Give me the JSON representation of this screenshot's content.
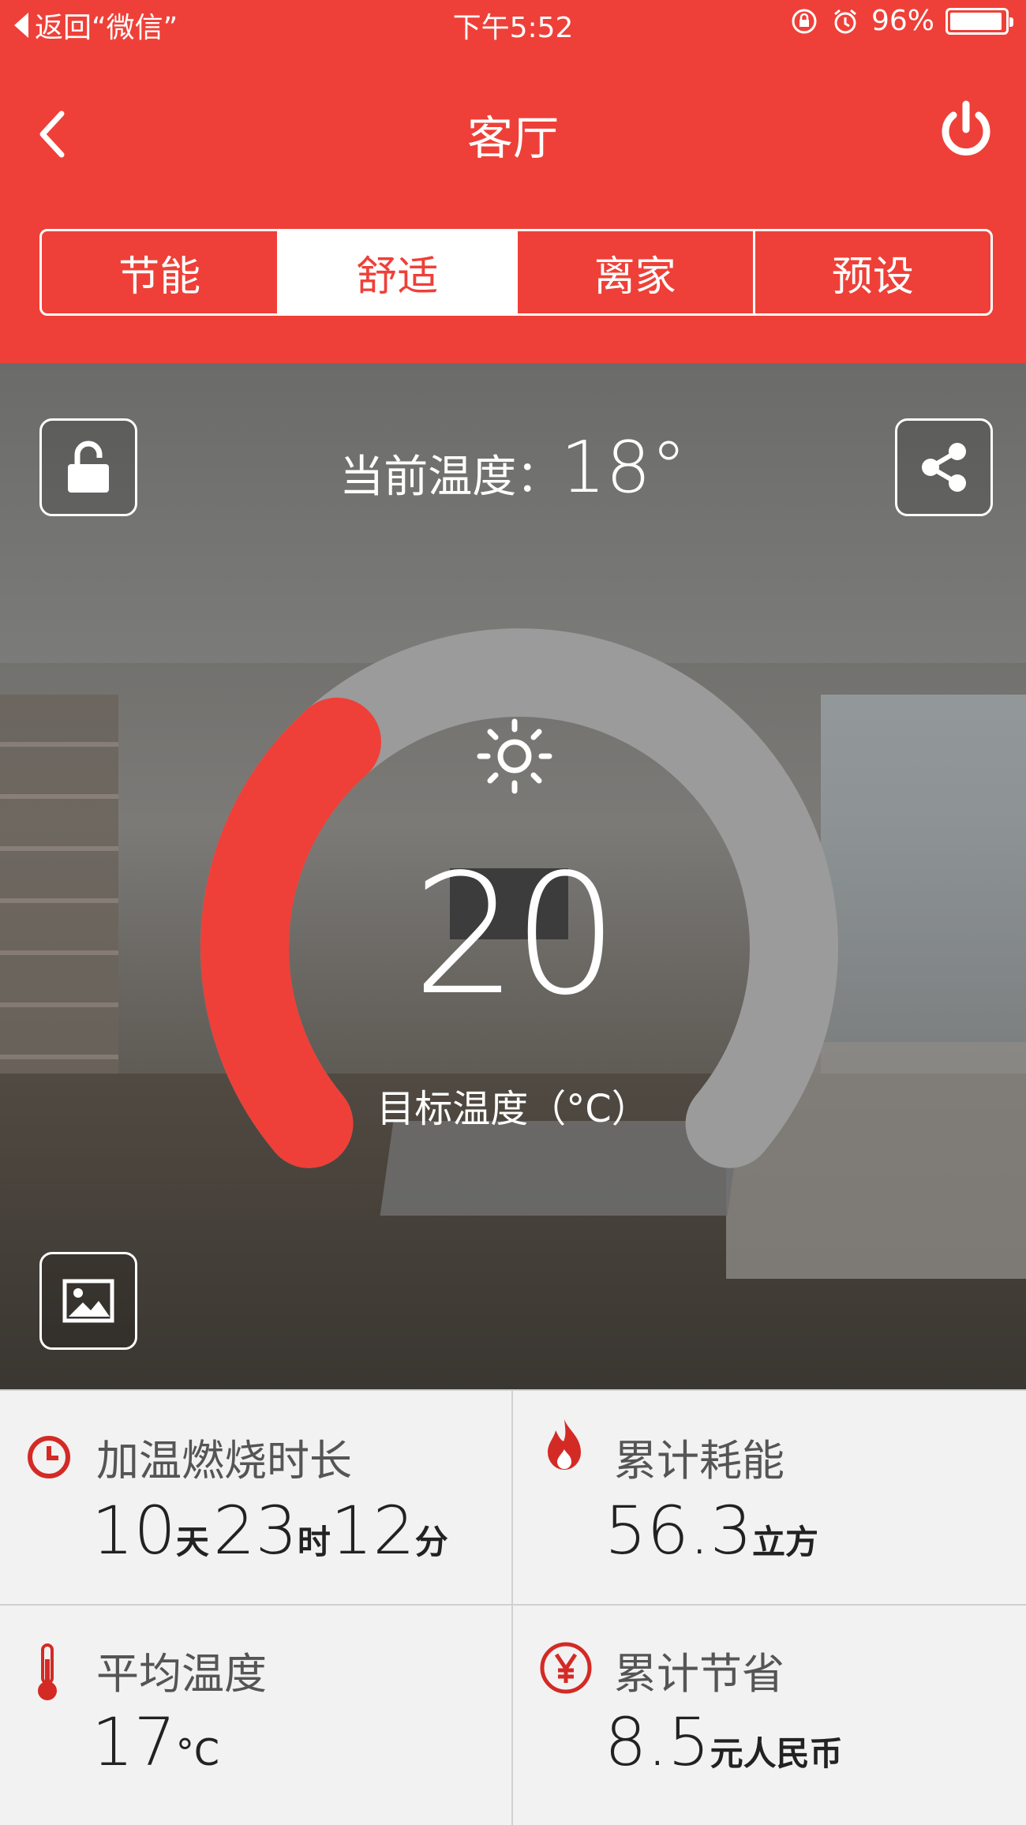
{
  "status_bar": {
    "back_label": "返回“微信”",
    "time": "下午5:52",
    "battery": "96%"
  },
  "nav": {
    "title": "客厅"
  },
  "tabs": [
    {
      "label": "节能",
      "active": false
    },
    {
      "label": "舒适",
      "active": true
    },
    {
      "label": "离家",
      "active": false
    },
    {
      "label": "预设",
      "active": false
    }
  ],
  "thermostat": {
    "current_label": "当前温度：",
    "current_value": "18°",
    "target_value": "20",
    "target_label": "目标温度（°C）",
    "level_fraction": 0.34
  },
  "stats": {
    "burn_time": {
      "label": "加温燃烧时长",
      "days": "10",
      "days_unit": "天",
      "hours": "23",
      "hours_unit": "时",
      "minutes": "12",
      "minutes_unit": "分"
    },
    "energy": {
      "label": "累计耗能",
      "value": "56.3",
      "unit": "立方"
    },
    "avg_temp": {
      "label": "平均温度",
      "value": "17",
      "unit": "°C"
    },
    "savings": {
      "label": "累计节省",
      "value": "8.5",
      "unit": "元人民币"
    }
  },
  "colors": {
    "accent": "#ee4038",
    "dial_track": "#9b9b9b"
  },
  "icons": {
    "lock": "lock-open-icon",
    "share": "share-icon",
    "image": "image-icon",
    "power": "power-icon",
    "sun": "sun-icon",
    "clock": "clock-icon",
    "flame": "flame-icon",
    "thermometer": "thermometer-icon",
    "yen": "yen-icon"
  }
}
